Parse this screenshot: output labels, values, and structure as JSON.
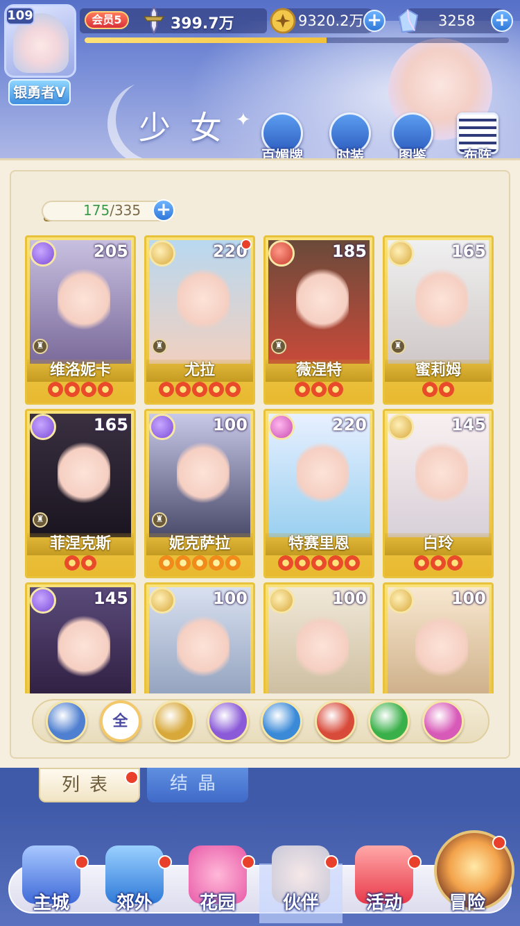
{
  "header": {
    "player_level": "109",
    "rank_title": "银勇者V",
    "vip_label": "会员5",
    "power": "399.7万",
    "exp_fraction": 0.57,
    "gold": "9320.2万",
    "gems": "3258",
    "plus_symbol": "+",
    "page_title": "少女",
    "buttons": [
      {
        "label": "百媚牌",
        "icon": "star-card-icon"
      },
      {
        "label": "时装",
        "icon": "outfit-icon"
      },
      {
        "label": "图鉴",
        "icon": "book-icon"
      },
      {
        "label": "布阵",
        "icon": "grid-icon"
      }
    ]
  },
  "roster": {
    "count_current": "175",
    "count_sep": "/",
    "count_total": "335",
    "cards": [
      {
        "name": "维洛妮卡",
        "level": "205",
        "element": "moon",
        "stars": 4,
        "star_color": "red",
        "red_dot": false,
        "rook": true
      },
      {
        "name": "尤拉",
        "level": "220",
        "element": "sun",
        "stars": 5,
        "star_color": "red",
        "red_dot": true,
        "rook": true
      },
      {
        "name": "薇涅特",
        "level": "185",
        "element": "fire",
        "stars": 3,
        "star_color": "red",
        "red_dot": false,
        "rook": true
      },
      {
        "name": "蜜莉姆",
        "level": "165",
        "element": "sun",
        "stars": 2,
        "star_color": "red",
        "red_dot": false,
        "rook": true
      },
      {
        "name": "菲涅克斯",
        "level": "165",
        "element": "moon",
        "stars": 2,
        "star_color": "red",
        "red_dot": false,
        "rook": true
      },
      {
        "name": "妮克萨拉",
        "level": "100",
        "element": "moon",
        "stars": 5,
        "star_color": "orange",
        "red_dot": false,
        "rook": true
      },
      {
        "name": "特赛里恩",
        "level": "220",
        "element": "star",
        "stars": 5,
        "star_color": "red",
        "red_dot": false,
        "rook": false
      },
      {
        "name": "白玲",
        "level": "145",
        "element": "sun",
        "stars": 3,
        "star_color": "red",
        "red_dot": false,
        "rook": false
      },
      {
        "name": "",
        "level": "145",
        "element": "moon",
        "stars": 0,
        "star_color": "red",
        "red_dot": false,
        "rook": false
      },
      {
        "name": "",
        "level": "100",
        "element": "sun",
        "stars": 0,
        "star_color": "red",
        "red_dot": false,
        "rook": false
      },
      {
        "name": "",
        "level": "100",
        "element": "sun",
        "stars": 0,
        "star_color": "red",
        "red_dot": false,
        "rook": false
      },
      {
        "name": "",
        "level": "100",
        "element": "sun",
        "stars": 0,
        "star_color": "red",
        "red_dot": false,
        "rook": false
      }
    ]
  },
  "filters": [
    {
      "id": "wind",
      "label": "",
      "icon": "wind-chevron-icon",
      "color": "#4f7fd0",
      "active": false
    },
    {
      "id": "all",
      "label": "全",
      "icon": "all-icon",
      "color": "#ffffff",
      "active": true
    },
    {
      "id": "sun",
      "label": "",
      "icon": "sun-icon",
      "color": "#d8a83a",
      "active": false
    },
    {
      "id": "moon",
      "label": "",
      "icon": "moon-icon",
      "color": "#8a5ad8",
      "active": false
    },
    {
      "id": "water",
      "label": "",
      "icon": "water-drop-icon",
      "color": "#3a8ad8",
      "active": false
    },
    {
      "id": "fire",
      "label": "",
      "icon": "flame-icon",
      "color": "#d84a3a",
      "active": false
    },
    {
      "id": "tornado",
      "label": "",
      "icon": "tornado-icon",
      "color": "#3ab04a",
      "active": false
    },
    {
      "id": "star",
      "label": "",
      "icon": "orbit-icon",
      "color": "#d85ab8",
      "active": false
    }
  ],
  "tabs": {
    "list": "列表",
    "crystal": "结晶"
  },
  "nav": [
    {
      "label": "主城",
      "icon": "castle-icon",
      "active": false,
      "dot": true
    },
    {
      "label": "郊外",
      "icon": "gate-icon",
      "active": false,
      "dot": true
    },
    {
      "label": "花园",
      "icon": "heart-icon",
      "active": false,
      "dot": true
    },
    {
      "label": "伙伴",
      "icon": "partner-icon",
      "active": true,
      "dot": true
    },
    {
      "label": "活动",
      "icon": "gift-icon",
      "active": false,
      "dot": true
    },
    {
      "label": "冒险",
      "icon": "compass-icon",
      "active": false,
      "dot": true
    }
  ],
  "colors": {
    "accent_blue": "#3f5aa8",
    "card_gold": "#e8c23a",
    "panel_bg": "#f6efe0",
    "badge_red": "#e8402a"
  }
}
